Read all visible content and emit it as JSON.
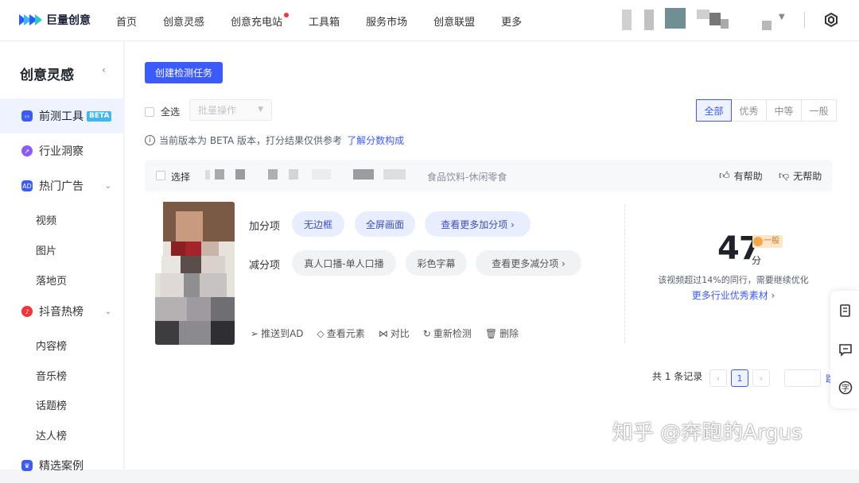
{
  "brand": {
    "name": "巨量创意"
  },
  "nav": [
    {
      "label": "首页",
      "dot": false
    },
    {
      "label": "创意灵感",
      "dot": false
    },
    {
      "label": "创意充电站",
      "dot": true
    },
    {
      "label": "工具箱",
      "dot": false
    },
    {
      "label": "服务市场",
      "dot": false
    },
    {
      "label": "创意联盟",
      "dot": false
    },
    {
      "label": "更多",
      "dot": false
    }
  ],
  "sidebar": {
    "title": "创意灵感",
    "collapse": "‹",
    "items": [
      {
        "label": "前测工具",
        "badge": "BETA",
        "icon": "code-icon",
        "active": true
      },
      {
        "label": "行业洞察",
        "icon": "compass-icon"
      },
      {
        "label": "热门广告",
        "icon": "ad-icon",
        "expand": "⌄"
      },
      {
        "label": "抖音热榜",
        "icon": "douyin-icon",
        "expand": "⌄"
      },
      {
        "label": "精选案例",
        "icon": "crown-icon"
      }
    ],
    "sub_ads": [
      "视频",
      "图片",
      "落地页"
    ],
    "sub_douyin": [
      "内容榜",
      "音乐榜",
      "话题榜",
      "达人榜"
    ]
  },
  "toolbar": {
    "create_label": "创建检测任务",
    "select_all": "全选",
    "batch_placeholder": "批量操作",
    "filters": [
      {
        "label": "全部",
        "active": true
      },
      {
        "label": "优秀"
      },
      {
        "label": "中等"
      },
      {
        "label": "一般"
      }
    ]
  },
  "notice": {
    "text": "当前版本为 BETA 版本，打分结果仅供参考",
    "link": "了解分数构成"
  },
  "card": {
    "select_label": "选择",
    "category": "食品饮料-休闲零食",
    "helpful": "有帮助",
    "unhelpful": "无帮助",
    "plus_label": "加分项",
    "minus_label": "减分项",
    "plus_tags": [
      "无边框",
      "全屏画面",
      "查看更多加分项 ›"
    ],
    "minus_tags": [
      "真人口播-单人口播",
      "彩色字幕",
      "查看更多减分项 ›"
    ],
    "score": "47",
    "score_unit": "分",
    "grade": "一般",
    "score_desc": "该视频超过14%的同行，需要继续优化",
    "score_link": "更多行业优秀素材 ›",
    "actions": [
      {
        "label": "推送到AD",
        "icon": "send-icon",
        "glyph": "➢"
      },
      {
        "label": "查看元素",
        "icon": "tag-icon",
        "glyph": "◇"
      },
      {
        "label": "对比",
        "icon": "compare-icon",
        "glyph": "⋈"
      },
      {
        "label": "重新检测",
        "icon": "refresh-icon",
        "glyph": "↻"
      },
      {
        "label": "删除",
        "icon": "trash-icon",
        "glyph": "🗑"
      }
    ]
  },
  "pager": {
    "total": "共 1 条记录",
    "prev": "‹",
    "current": "1",
    "next": "›",
    "jump": "跳"
  },
  "watermark": {
    "text": "知乎 @奔跑的Argus"
  },
  "colors": {
    "primary": "#3b5bff",
    "beta": "#3fb8f0",
    "grade_bg": "#fde7c7"
  }
}
